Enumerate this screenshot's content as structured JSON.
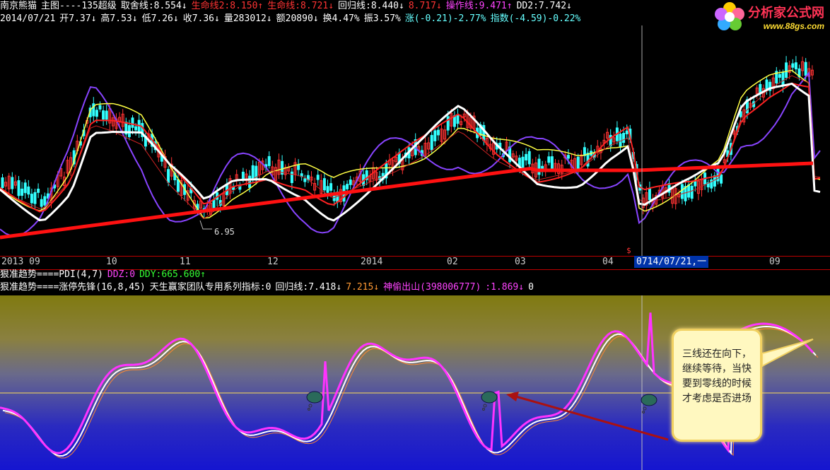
{
  "header": {
    "row1": [
      {
        "text": "南京熊猫",
        "color": "#ffffff"
      },
      {
        "text": "主图----135超级",
        "color": "#ffffff"
      },
      {
        "text": "取舍线:8.554↓",
        "color": "#ffffff"
      },
      {
        "text": "生命线2:8.150↑",
        "color": "#ff3333"
      },
      {
        "text": "生命线:8.721↓",
        "color": "#ff3333"
      },
      {
        "text": "回归线:8.440↓",
        "color": "#ffffff"
      },
      {
        "text": "8.717↓",
        "color": "#ff3333"
      },
      {
        "text": "操作线:9.471↑",
        "color": "#ff44ff"
      },
      {
        "text": "DD2:7.742↓",
        "color": "#ffffff"
      }
    ],
    "row2": [
      {
        "text": "2014/07/21",
        "color": "#ffffff"
      },
      {
        "text": "开7.37↓",
        "color": "#ffffff"
      },
      {
        "text": "高7.53↓",
        "color": "#ffffff"
      },
      {
        "text": "低7.26↓",
        "color": "#ffffff"
      },
      {
        "text": "收7.36↓",
        "color": "#ffffff"
      },
      {
        "text": "量283012↓",
        "color": "#ffffff"
      },
      {
        "text": "额20890↓",
        "color": "#ffffff"
      },
      {
        "text": "换4.47%",
        "color": "#ffffff"
      },
      {
        "text": "振3.57%",
        "color": "#ffffff"
      },
      {
        "text": "涨(-0.21)-2.77%",
        "color": "#66ffff"
      },
      {
        "text": "指数(-4.59)-0.22%",
        "color": "#66ffff"
      }
    ]
  },
  "logo": {
    "title": "分析家公式网",
    "url": "www.88gs.com"
  },
  "main_chart": {
    "low_label": "6.95",
    "price_range": [
      6.6,
      10.9
    ],
    "candles": [],
    "markers": {
      "s_marker": "$"
    }
  },
  "time_axis": {
    "labels": [
      "2013 09",
      "10",
      "11",
      "12",
      "2014",
      "02",
      "03",
      "04",
      "07",
      "09"
    ],
    "cursor_date": "14/07/21,一"
  },
  "indicator_rows": [
    [
      {
        "text": "狠准趋势====PDI(4,7)",
        "color": "#ffffff"
      },
      {
        "text": "DDZ:0",
        "color": "#ff44ff"
      },
      {
        "text": "DDY:665.600↑",
        "color": "#33ff33"
      }
    ],
    [
      {
        "text": "狠准趋势====涨停先锋(16,8,45)",
        "color": "#ffffff"
      },
      {
        "text": "天生赢家团队专用系列指标:0",
        "color": "#ffffff"
      },
      {
        "text": "回归线:7.418↓",
        "color": "#ffffff"
      },
      {
        "text": "7.215↓",
        "color": "#ff9933"
      },
      {
        "text": "神偷出山(398006777)",
        "color": "#ff44ff"
      },
      {
        "text": ":1.869↓",
        "color": "#ff44ff"
      },
      {
        "text": "0",
        "color": "#ffffff"
      }
    ]
  ],
  "callout": {
    "text": "三线还在向下，继续等待，当快要到零线的时候才考虑是否进场"
  },
  "colors": {
    "up": "#ff3333",
    "down": "#33ffff",
    "ma_white": "#ffffff",
    "ma_yellow": "#ffff44",
    "ma_red": "#ff2222",
    "ma_purple": "#8844ff",
    "life_line": "#ff1111"
  }
}
